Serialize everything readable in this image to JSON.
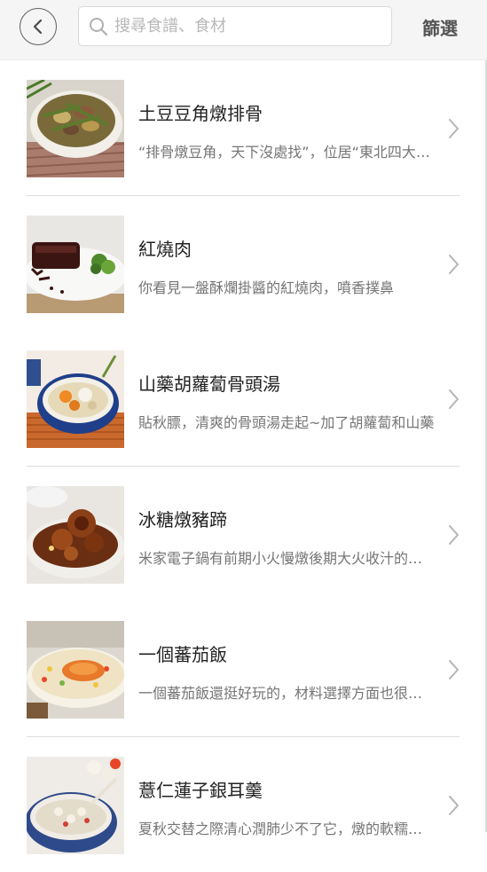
{
  "header": {
    "back_icon": "chevron-left-icon",
    "search_icon": "search-icon",
    "search_placeholder": "搜尋食譜、食材",
    "search_value": "",
    "filter_label": "篩選"
  },
  "recipes": [
    {
      "title": "土豆豆角燉排骨",
      "description": "“排骨燉豆角，天下沒處找”，位居“東北四大燉”之一的豆角燉排骨",
      "thumb": "stewed-ribs-with-beans-photo",
      "has_divider": true
    },
    {
      "title": "紅燒肉",
      "description": "你看見一盤酥爛掛醬的紅燒肉，噴香撲鼻",
      "thumb": "braised-pork-photo",
      "has_divider": false
    },
    {
      "title": "山藥胡蘿蔔骨頭湯",
      "description": "貼秋膘，清爽的骨頭湯走起~加了胡蘿蔔和山藥",
      "thumb": "yam-carrot-bone-soup-photo",
      "has_divider": true
    },
    {
      "title": "冰糖燉豬蹄",
      "description": "米家電子鍋有前期小火慢燉後期大火收汁的功能",
      "thumb": "rock-sugar-pork-trotter-photo",
      "has_divider": false
    },
    {
      "title": "一個蕃茄飯",
      "description": "一個蕃茄飯還挺好玩的，材料選擇方面也很簡單",
      "thumb": "tomato-rice-photo",
      "has_divider": true
    },
    {
      "title": "薏仁蓮子銀耳羹",
      "description": "夏秋交替之際清心潤肺少不了它，燉的軟糯香甜",
      "thumb": "lotus-seed-tremella-soup-photo",
      "has_divider": false
    }
  ],
  "colors": {
    "header_bg": "#f5f5f5",
    "title_text": "#222222",
    "desc_text": "#757575",
    "divider": "#dedede"
  }
}
